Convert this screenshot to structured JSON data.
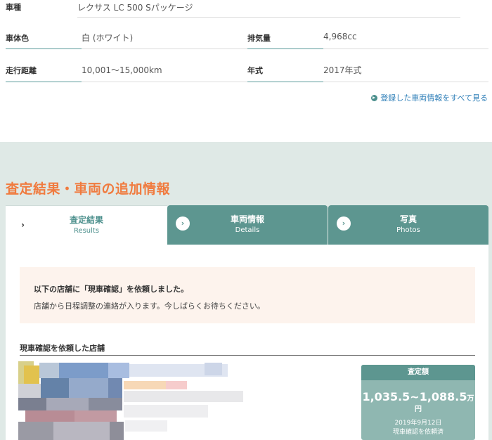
{
  "spec": {
    "model_label": "車種",
    "model_value": "レクサス LC 500 Sパッケージ",
    "color_label": "車体色",
    "color_value": "白 (ホワイト)",
    "displacement_label": "排気量",
    "displacement_value": "4,968cc",
    "mileage_label": "走行距離",
    "mileage_value": "10,001～15,000km",
    "year_label": "年式",
    "year_value": "2017年式",
    "see_all_link": "登録した車両情報をすべて見る"
  },
  "section": {
    "title": "査定結果・車両の追加情報"
  },
  "tabs": [
    {
      "label": "査定結果",
      "sub": "Results",
      "active": true,
      "icon": "chevron-right-icon"
    },
    {
      "label": "車両情報",
      "sub": "Details",
      "active": false,
      "icon": "chevron-circle-right-icon"
    },
    {
      "label": "写真",
      "sub": "Photos",
      "active": false,
      "icon": "chevron-circle-right-icon"
    }
  ],
  "notice": {
    "title": "以下の店舗に「現車確認」を依頼しました。",
    "text": "店舗から日程調整の連絡が入ります。今しばらくお待ちください。"
  },
  "store": {
    "heading": "現車確認を依頼した店舗"
  },
  "price": {
    "header": "査定額",
    "range": "1,035.5~1,088.5",
    "unit_man": "万",
    "unit_yen": "円",
    "date": "2019年9月12日",
    "status": "現車確認を依頼済"
  },
  "colors": {
    "accent_orange": "#f07b3f",
    "teal_dark": "#5d9690",
    "teal_light": "#8fb7b1",
    "section_bg": "#dfe9e6",
    "notice_bg": "#fdf3ed",
    "link_blue": "#2f7fb8"
  }
}
